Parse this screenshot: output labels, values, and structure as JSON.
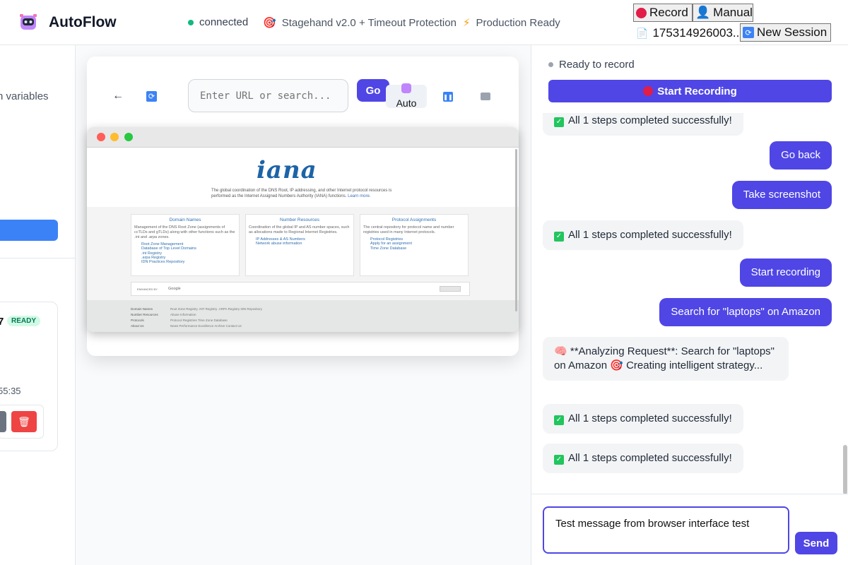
{
  "header": {
    "brand": "AutoFlow",
    "status_connected": "connected",
    "status_engine": "Stagehand v2.0 + Timeout Protection",
    "status_ready": "Production Ready",
    "record_btn": "Record",
    "manual_btn": "Manual",
    "session_id": "175314926003...",
    "new_session_btn": "New Session"
  },
  "sidebar": {
    "variables_text": "n variables",
    "session_suffix": "7",
    "ready_badge": "READY",
    "time_fragment": "55:35"
  },
  "browser": {
    "back_label": "←",
    "url_placeholder": "Enter URL or search...",
    "go_label": "Go",
    "auto_label": "Auto",
    "site": {
      "logo_text": "iana",
      "intro": "The global coordination of the DNS Root, IP addressing, and other Internet protocol resources is performed as the Internet Assigned Numbers Authority (IANA) functions.",
      "learn_more": "Learn more.",
      "sections": [
        {
          "title": "Domain Names",
          "body": "Management of the DNS Root Zone (assignments of ccTLDs and gTLDs) along with other functions such as the .int and .arpa zones.",
          "links": [
            "Root Zone Management",
            "Database of Top Level Domains",
            ".int Registry",
            ".arpa Registry",
            "IDN Practices Repository"
          ]
        },
        {
          "title": "Number Resources",
          "body": "Coordination of the global IP and AS number spaces, such as allocations made to Regional Internet Registries.",
          "links": [
            "IP Addresses & AS Numbers",
            "Network abuse information"
          ]
        },
        {
          "title": "Protocol Assignments",
          "body": "The central repository for protocol name and number registries used in many Internet protocols.",
          "links": [
            "Protocol Registries",
            "Apply for an assignment",
            "Time Zone Database"
          ]
        }
      ],
      "search_label": "ENHANCED BY",
      "search_brand": "Google",
      "footer_rows": [
        {
          "head": "Domain Names",
          "links": "Root Zone Registry   .INT Registry   .ARPA Registry   IDN Repository"
        },
        {
          "head": "Number Resources",
          "links": "Abuse Information"
        },
        {
          "head": "Protocols",
          "links": "Protocol Registries   Time Zone Database"
        },
        {
          "head": "About Us",
          "links": "News   Performance   Excellence   Archive   Contact Us"
        }
      ]
    }
  },
  "recorder": {
    "status": "Ready to record",
    "start_btn": "Start Recording"
  },
  "chat": {
    "messages": [
      {
        "role": "bot",
        "text": "All 1 steps completed successfully!"
      },
      {
        "role": "user",
        "text": "Go back"
      },
      {
        "role": "user",
        "text": "Take screenshot"
      },
      {
        "role": "bot",
        "text": "All 1 steps completed successfully!"
      },
      {
        "role": "user",
        "text": "Start recording"
      },
      {
        "role": "user",
        "text": "Search for \"laptops\" on Amazon"
      },
      {
        "role": "bot",
        "text": "**Analyzing Request**: Search for \"laptops\" on Amazon"
      },
      {
        "role": "bot",
        "text": "Creating intelligent strategy..."
      },
      {
        "role": "bot",
        "text": "All 1 steps completed successfully!"
      },
      {
        "role": "bot",
        "text": "All 1 steps completed successfully!"
      }
    ]
  },
  "composer": {
    "value": "Test message from browser interface test",
    "send_btn": "Send"
  },
  "colors": {
    "accent": "#4f46e5",
    "success": "#10b981",
    "danger": "#ef4444",
    "sidebar_blue": "#3b82f6"
  }
}
